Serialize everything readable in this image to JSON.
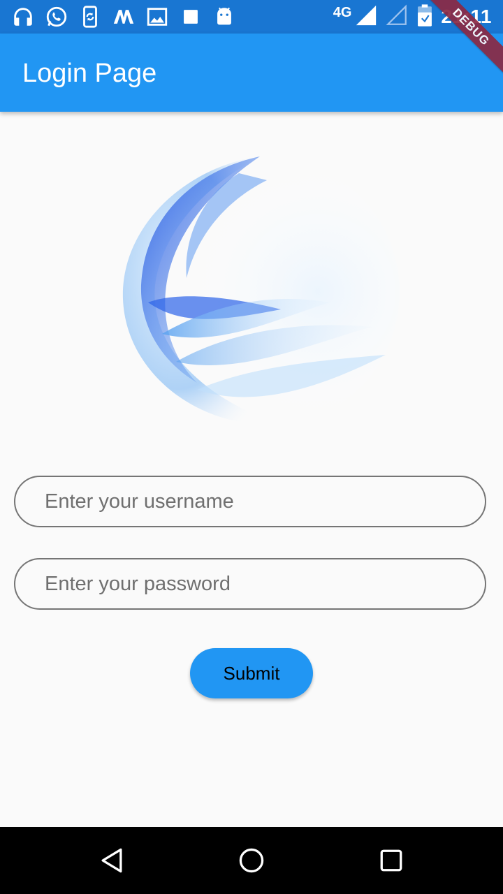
{
  "status_bar": {
    "icons": [
      "headphones-icon",
      "whatsapp-icon",
      "phone-sync-icon",
      "m-app-icon",
      "gallery-icon",
      "square-notification-icon",
      "android-icon"
    ],
    "network_type": "4G",
    "time": "21:11",
    "background_color": "#1976d2"
  },
  "debug_banner": {
    "label": "DEBUG",
    "color": "#8b2a44"
  },
  "app_bar": {
    "title": "Login Page",
    "background_color": "#2196f3"
  },
  "form": {
    "username": {
      "placeholder": "Enter your username",
      "value": ""
    },
    "password": {
      "placeholder": "Enter your password",
      "value": ""
    },
    "submit_label": "Submit"
  },
  "nav_bar": {
    "buttons": [
      "back-icon",
      "home-icon",
      "recents-icon"
    ]
  },
  "colors": {
    "accent": "#2196f3",
    "background": "#fafafa",
    "field_border": "#757575"
  }
}
